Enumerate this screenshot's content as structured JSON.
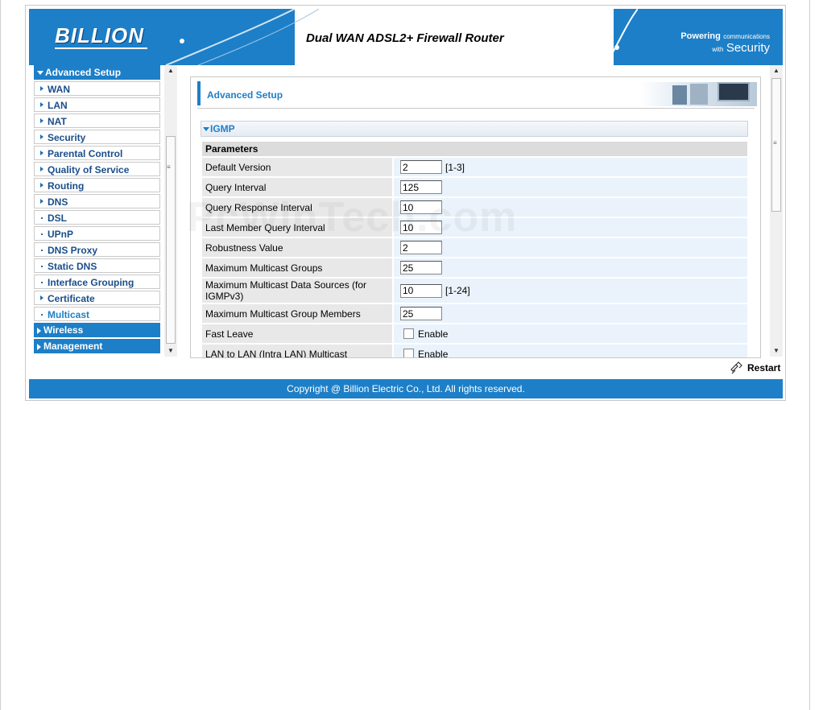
{
  "header": {
    "logo": "BILLION",
    "title": "Dual WAN ADSL2+ Firewall Router",
    "tagline_1": "Powering",
    "tagline_2": "communications",
    "tagline_3": "with",
    "tagline_4": "Security"
  },
  "sidebar": {
    "advanced_setup": "Advanced Setup",
    "items": [
      "WAN",
      "LAN",
      "NAT",
      "Security",
      "Parental Control",
      "Quality of Service",
      "Routing",
      "DNS",
      "DSL",
      "UPnP",
      "DNS Proxy",
      "Static DNS",
      "Interface Grouping",
      "Certificate",
      "Multicast"
    ],
    "wireless": "Wireless",
    "management": "Management"
  },
  "content": {
    "section_title": "Advanced Setup",
    "subsection": "IGMP",
    "params_header": "Parameters",
    "rows": [
      {
        "label": "Default Version",
        "value": "2",
        "range": "[1-3]"
      },
      {
        "label": "Query Interval",
        "value": "125",
        "range": ""
      },
      {
        "label": "Query Response Interval",
        "value": "10",
        "range": ""
      },
      {
        "label": "Last Member Query Interval",
        "value": "10",
        "range": ""
      },
      {
        "label": "Robustness Value",
        "value": "2",
        "range": ""
      },
      {
        "label": "Maximum Multicast Groups",
        "value": "25",
        "range": ""
      },
      {
        "label": "Maximum Multicast Data Sources (for IGMPv3)",
        "value": "10",
        "range": "[1-24]"
      },
      {
        "label": "Maximum Multicast Group Members",
        "value": "25",
        "range": ""
      }
    ],
    "fast_leave_label": "Fast Leave",
    "fast_leave_option": "Enable",
    "lan_to_lan_label": "LAN to LAN (Intra LAN) Multicast",
    "lan_to_lan_option": "Enable"
  },
  "restart_label": "Restart",
  "footer": "Copyright @ Billion Electric Co., Ltd. All rights reserved.",
  "watermark": "PcWinTech.com"
}
